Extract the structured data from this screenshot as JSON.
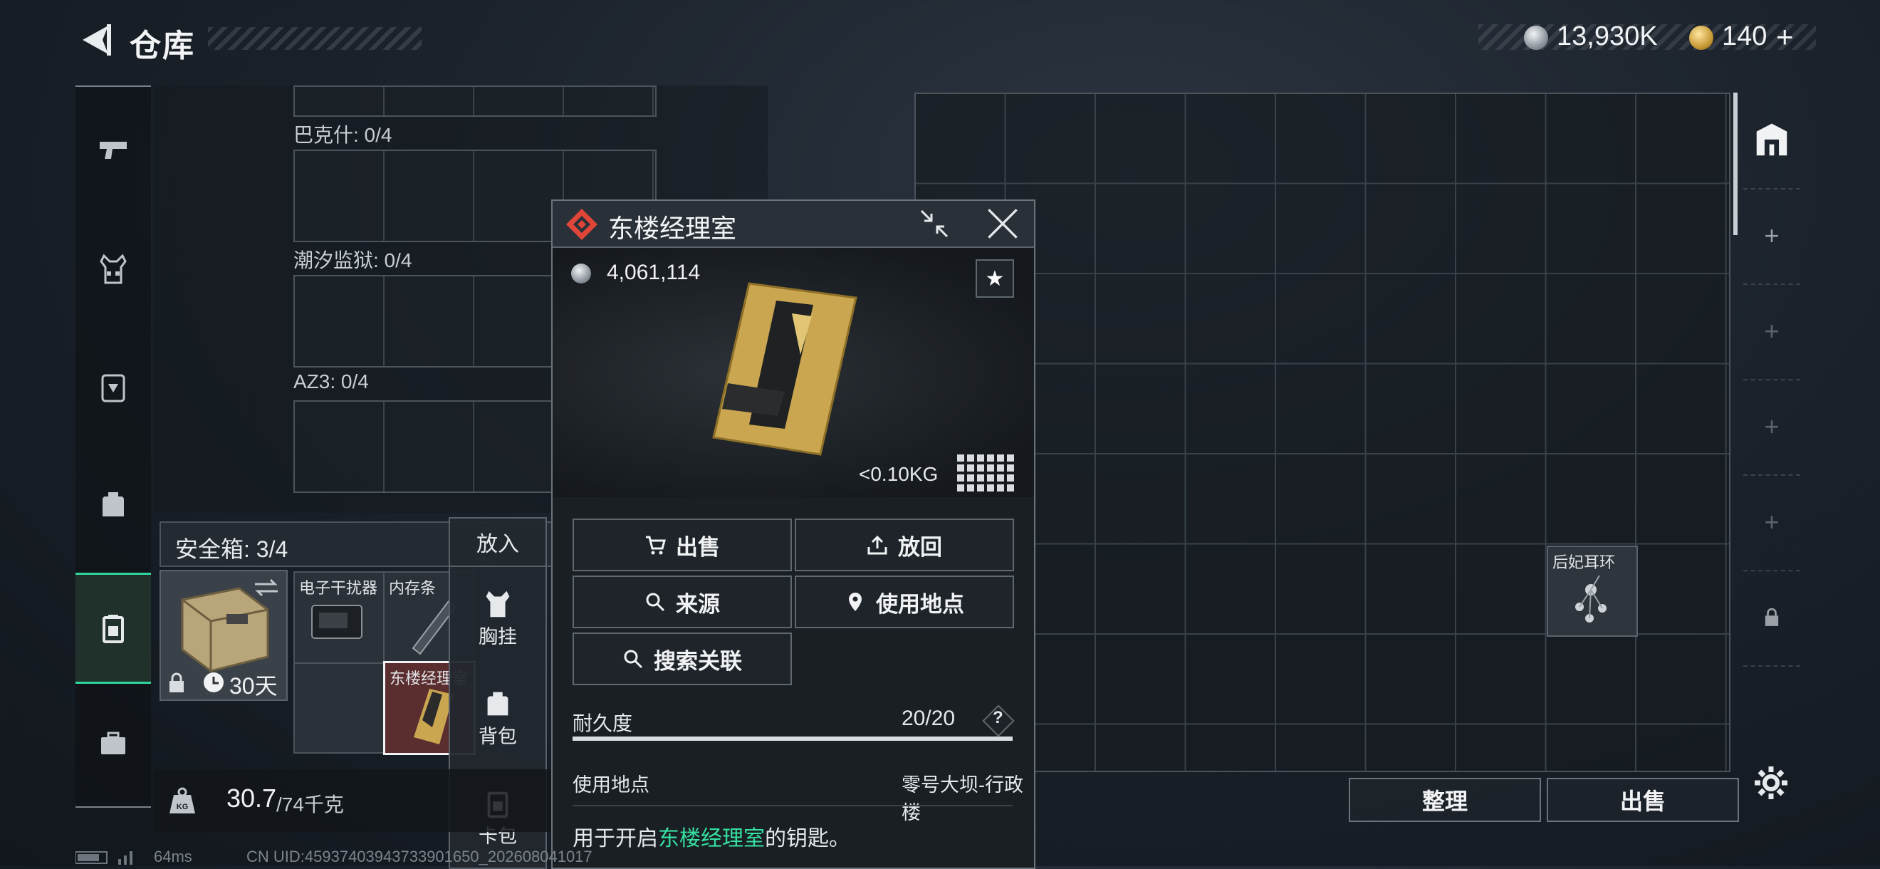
{
  "header": {
    "title": "仓库",
    "currency_silver": "13,930K",
    "currency_gold": "140",
    "gold_plus": "+"
  },
  "nav": {
    "items": [
      {
        "name": "weapons",
        "icon": "pistol-icon"
      },
      {
        "name": "vest",
        "icon": "vest-icon"
      },
      {
        "name": "armor",
        "icon": "armor-icon"
      },
      {
        "name": "backpack",
        "icon": "backpack-icon"
      },
      {
        "name": "safebox",
        "icon": "safebox-icon",
        "active": true
      },
      {
        "name": "toolbox",
        "icon": "toolbox-icon"
      }
    ]
  },
  "slots": {
    "group1": "巴克什: 0/4",
    "group2": "潮汐监狱: 0/4",
    "group3": "AZ3: 0/4"
  },
  "safebox": {
    "label": "安全箱: 3/4",
    "help": "?",
    "duration": "30天",
    "items": [
      "电子干扰器",
      "内存条",
      "东楼经理室"
    ]
  },
  "putin_menu": {
    "title": "放入",
    "items": [
      "胸挂",
      "背包",
      "卡包"
    ]
  },
  "weight": {
    "current": "30.7",
    "max": "/74千克",
    "unit_icon": "KG"
  },
  "item_popup": {
    "title": "东楼经理室",
    "price": "4,061,114",
    "weight": "<0.10KG",
    "buttons": {
      "sell": "出售",
      "return": "放回",
      "source": "来源",
      "use_location": "使用地点",
      "search_related": "搜索关联"
    },
    "durability_label": "耐久度",
    "durability_value": "20/20",
    "durability_fraction": 1.0,
    "use_location_label": "使用地点",
    "use_location_value": "零号大坝-行政楼",
    "desc_prefix": "用于开启",
    "desc_highlight": "东楼经理室",
    "desc_suffix": "的钥匙。"
  },
  "stash": {
    "item_label": "后妃耳环"
  },
  "actions": {
    "organize": "整理",
    "sell": "出售"
  },
  "status_bar": {
    "ping": "64ms",
    "uid": "CN UID:4593740394373390165​0_202608041017"
  },
  "colors": {
    "accent_green": "#2fd89a",
    "rarity_red": "#e0453a",
    "highlight_text": "#35e0a0"
  }
}
